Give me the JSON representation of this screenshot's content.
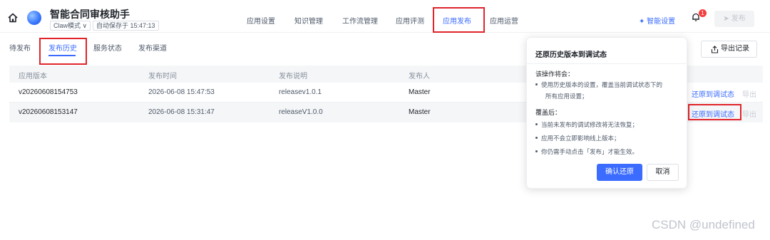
{
  "header": {
    "app_title": "智能合同审核助手",
    "mode_label": "Claw模式 ∨",
    "save_status": "自动保存于 15:47:13",
    "nav": [
      "应用设置",
      "知识管理",
      "工作流管理",
      "应用评测",
      "应用发布",
      "应用运营"
    ],
    "active_nav": "应用发布",
    "smart_settings": "✦ 智能设置",
    "notification_count": "1",
    "publish_button": "➤ 发布",
    "accent_color": "#3b6cff",
    "highlight_color": "#e0242b"
  },
  "subtabs": {
    "items": [
      "待发布",
      "发布历史",
      "服务状态",
      "发布渠道"
    ],
    "active": "发布历史",
    "export_label": "导出记录"
  },
  "table": {
    "columns": [
      "应用版本",
      "发布时间",
      "发布说明",
      "发布人"
    ],
    "rows": [
      {
        "version": "v20260608154753",
        "time": "2026-06-08 15:47:53",
        "note": "releasev1.0.1",
        "publisher": "Master",
        "restore": "还原到调试态",
        "export": "导出"
      },
      {
        "version": "v20260608153147",
        "time": "2026-06-08 15:31:47",
        "note": "releaseV1.0.0",
        "publisher": "Master",
        "restore": "还原到调试态",
        "export": "导出"
      }
    ]
  },
  "popover": {
    "title": "还原历史版本到调试态",
    "section1": "该操作将会：",
    "bullet1_line1": "使用历史版本的设置，覆盖当前调试状态下的",
    "bullet1_line2": "所有应用设置；",
    "section2": "覆盖后：",
    "bullets2": [
      "当前未发布的调试修改将无法恢复；",
      "应用不会立即影响线上版本；",
      "你仍需手动点击「发布」才能生效。"
    ],
    "confirm": "确认还原",
    "cancel": "取消"
  },
  "watermark": "CSDN @undefined"
}
